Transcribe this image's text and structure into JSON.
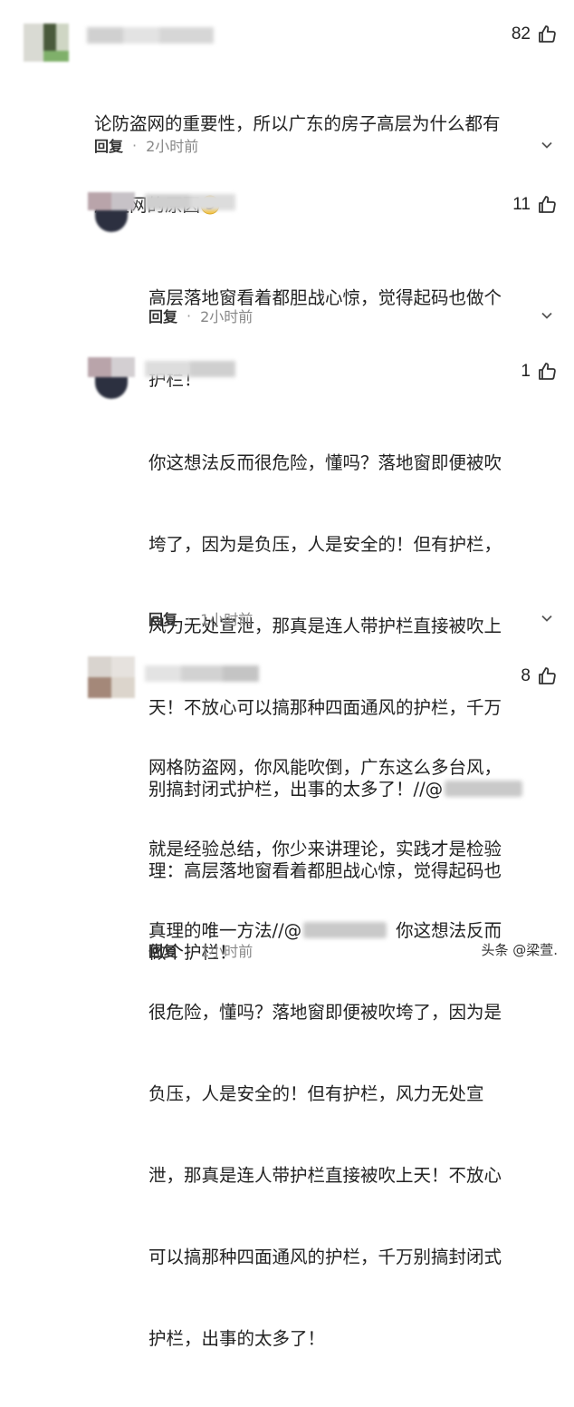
{
  "comments": [
    {
      "likes": "82",
      "text_lines": [
        "论防盗网的重要性，所以广东的房子高层为什么都有",
        "房盗网的原因"
      ],
      "reply_label": "回复",
      "time": "2小时前"
    },
    {
      "likes": "11",
      "text_lines": [
        "高层落地窗看着都胆战心惊，觉得起码也做个",
        "护栏！"
      ],
      "reply_label": "回复",
      "time": "2小时前"
    },
    {
      "likes": "1",
      "text_lines": [
        "你这想法反而很危险，懂吗？落地窗即便被吹",
        "垮了，因为是负压，人是安全的！但有护栏，",
        "风力无处宣泄，那真是连人带护栏直接被吹上",
        "天！不放心可以搞那种四面通风的护栏，千万",
        "别搞封闭式护栏，出事的太多了！//@",
        "理：高层落地窗看着都胆战心惊，觉得起码也",
        "做个护栏！"
      ],
      "reply_label": "回复",
      "time": "1小时前"
    },
    {
      "likes": "8",
      "text_lines": [
        "网格防盗网，你风能吹倒，广东这么多台风，",
        "就是经验总结，你少来讲理论，实践才是检验",
        "真理的唯一方法//@",
        "你这想法反而",
        "很危险，懂吗？落地窗即便被吹垮了，因为是",
        "负压，人是安全的！但有护栏，风力无处宣",
        "泄，那真是连人带护栏直接被吹上天！不放心",
        "可以搞那种四面通风的护栏，千万别搞封闭式",
        "护栏，出事的太多了！"
      ],
      "reply_label": "回复",
      "time": "1小时前"
    }
  ],
  "watermark": "头条 @梁萱.",
  "icons": {
    "thumb": "thumbs-up-icon",
    "more": "chevron-down-icon",
    "emoji": "smirk-emoji-icon"
  },
  "colors": {
    "text": "#222222",
    "meta": "#888888"
  }
}
